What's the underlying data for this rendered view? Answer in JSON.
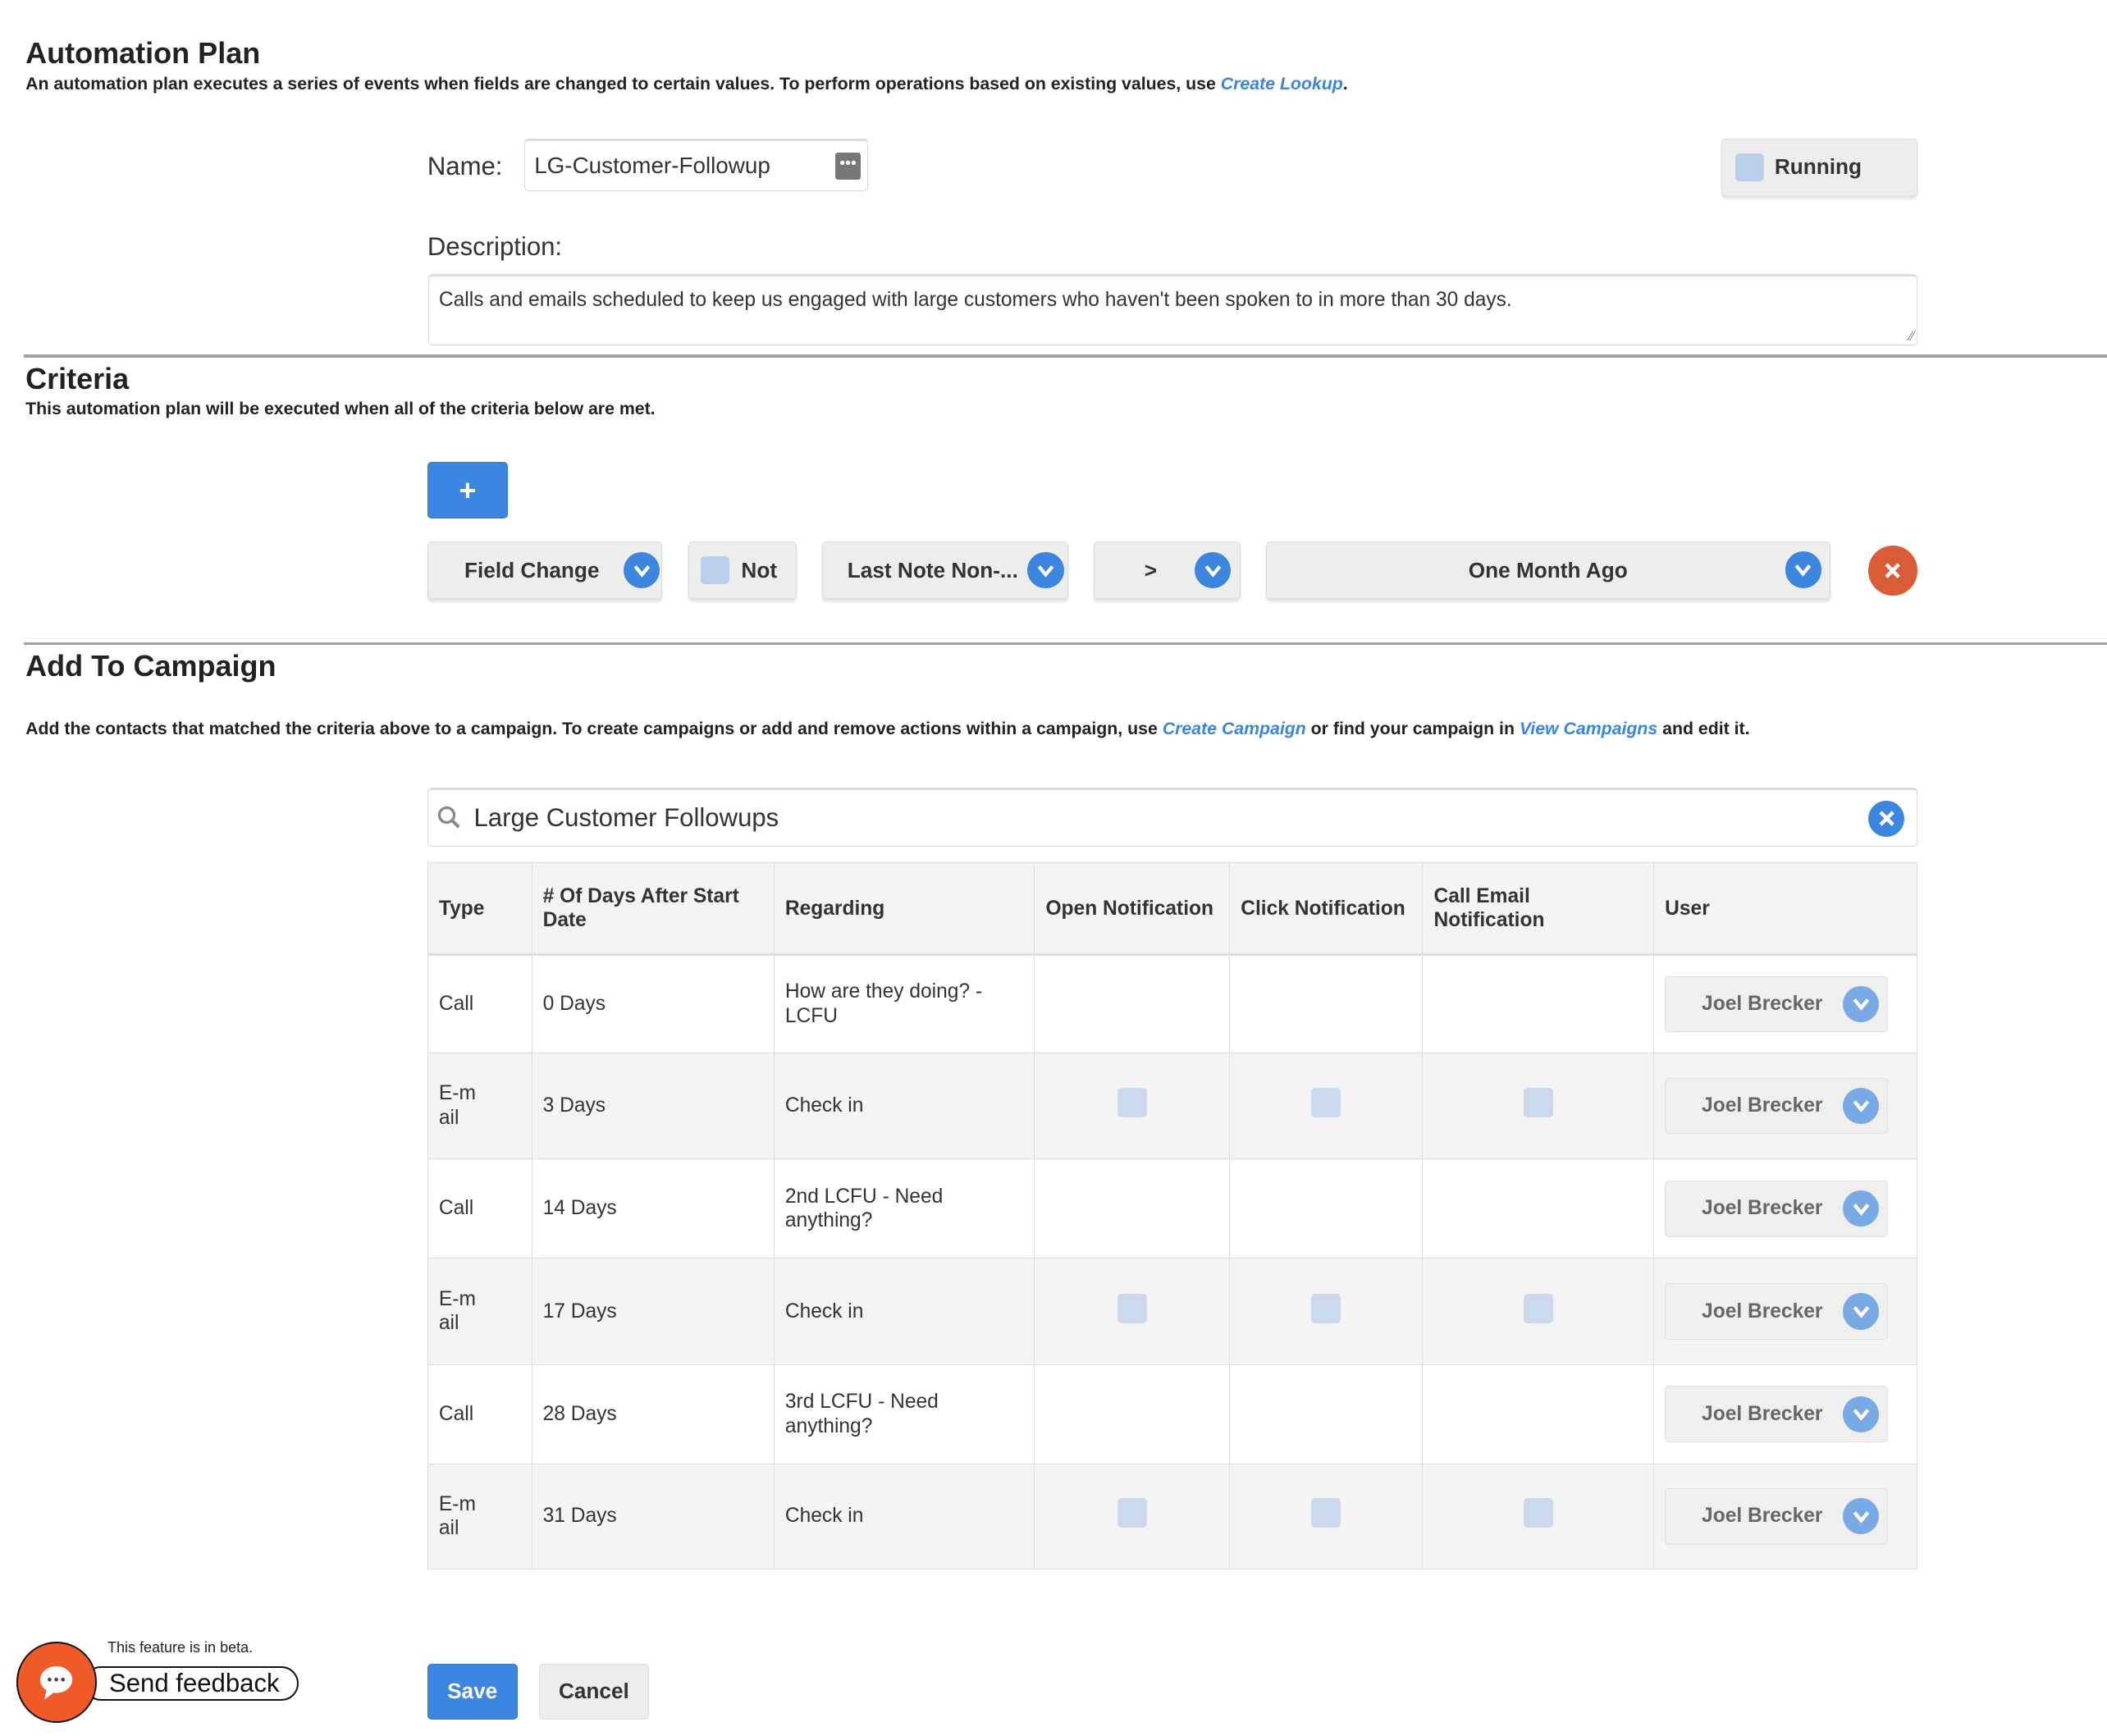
{
  "header": {
    "title": "Automation Plan",
    "description": "An automation plan executes a series of events when fields are changed to certain values. To perform operations based on existing values, use ",
    "link": "Create Lookup",
    "suffix": "."
  },
  "form": {
    "name_label": "Name:",
    "name_value": "LG-Customer-Followup",
    "running_label": "Running",
    "running_checked": false,
    "description_label": "Description:",
    "description_value": "Calls and emails scheduled to keep us engaged with large customers who haven't been spoken to in more than 30 days."
  },
  "criteria": {
    "title": "Criteria",
    "description": "This automation plan will be executed when all of the criteria below are met.",
    "add_label": "+",
    "row": {
      "type": "Field Change",
      "not_label": "Not",
      "not_checked": false,
      "field": "Last Note Non-...",
      "operator": ">",
      "value": "One Month Ago"
    }
  },
  "campaign": {
    "title": "Add To Campaign",
    "desc_a": "Add the contacts that matched the criteria above to a campaign. To create campaigns or add and remove actions within a campaign, use ",
    "link1": "Create Campaign",
    "desc_b": " or find your campaign in ",
    "link2": "View Campaigns",
    "desc_c": " and edit it.",
    "search_value": "Large Customer Followups"
  },
  "table": {
    "headers": [
      "Type",
      "# Of Days After Start Date",
      "Regarding",
      "Open Notification",
      "Click Notification",
      "Call Email Notification",
      "User"
    ],
    "rows": [
      {
        "type": "Call",
        "days": "0 Days",
        "regarding": "How are they doing? - LCFU",
        "user": "Joel Brecker"
      },
      {
        "type": "E-mail",
        "days": "3 Days",
        "regarding": "Check in",
        "user": "Joel Brecker"
      },
      {
        "type": "Call",
        "days": "14 Days",
        "regarding": "2nd LCFU - Need anything?",
        "user": "Joel Brecker"
      },
      {
        "type": "E-mail",
        "days": "17 Days",
        "regarding": "Check in",
        "user": "Joel Brecker"
      },
      {
        "type": "Call",
        "days": "28 Days",
        "regarding": "3rd LCFU - Need anything?",
        "user": "Joel Brecker"
      },
      {
        "type": "E-mail",
        "days": "31 Days",
        "regarding": "Check in",
        "user": "Joel Brecker"
      }
    ]
  },
  "footer": {
    "save": "Save",
    "cancel": "Cancel",
    "beta": "This feature is in beta.",
    "feedback": "Send feedback"
  },
  "colors": {
    "accent": "#3d86df",
    "danger": "#d95b38",
    "feedback": "#ef5a28",
    "link": "#3a86d8"
  }
}
